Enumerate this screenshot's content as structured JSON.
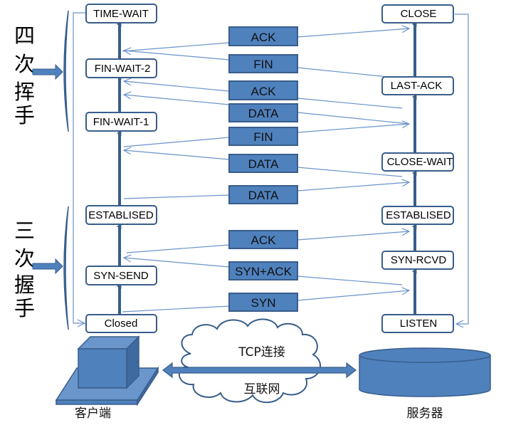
{
  "diagram": {
    "title_groups": {
      "four_way": "四次挥手",
      "three_way": "三次握手"
    },
    "client": {
      "label": "客户端",
      "states": [
        "TIME-WAIT",
        "FIN-WAIT-2",
        "FIN-WAIT-1",
        "ESTABLISED",
        "SYN-SEND",
        "Closed"
      ]
    },
    "server": {
      "label": "服务器",
      "states": [
        "CLOSE",
        "LAST-ACK",
        "CLOSE-WAIT",
        "ESTABLISED",
        "SYN-RCVD",
        "LISTEN"
      ]
    },
    "messages": [
      {
        "label": "ACK",
        "direction": "client-to-server"
      },
      {
        "label": "FIN",
        "direction": "server-to-client"
      },
      {
        "label": "ACK",
        "direction": "server-to-client"
      },
      {
        "label": "DATA",
        "direction": "server-to-client"
      },
      {
        "label": "FIN",
        "direction": "client-to-server"
      },
      {
        "label": "DATA",
        "direction": "server-to-client"
      },
      {
        "label": "DATA",
        "direction": "client-to-server"
      },
      {
        "label": "ACK",
        "direction": "client-to-server"
      },
      {
        "label": "SYN+ACK",
        "direction": "server-to-client"
      },
      {
        "label": "SYN",
        "direction": "client-to-server"
      }
    ],
    "network": {
      "connection_label": "TCP连接",
      "internet_label": "互联网"
    },
    "colors": {
      "fill": "#4f81bd",
      "stroke": "#385d8a",
      "line": "#6b93c9",
      "box_border": "#385d8a"
    }
  }
}
